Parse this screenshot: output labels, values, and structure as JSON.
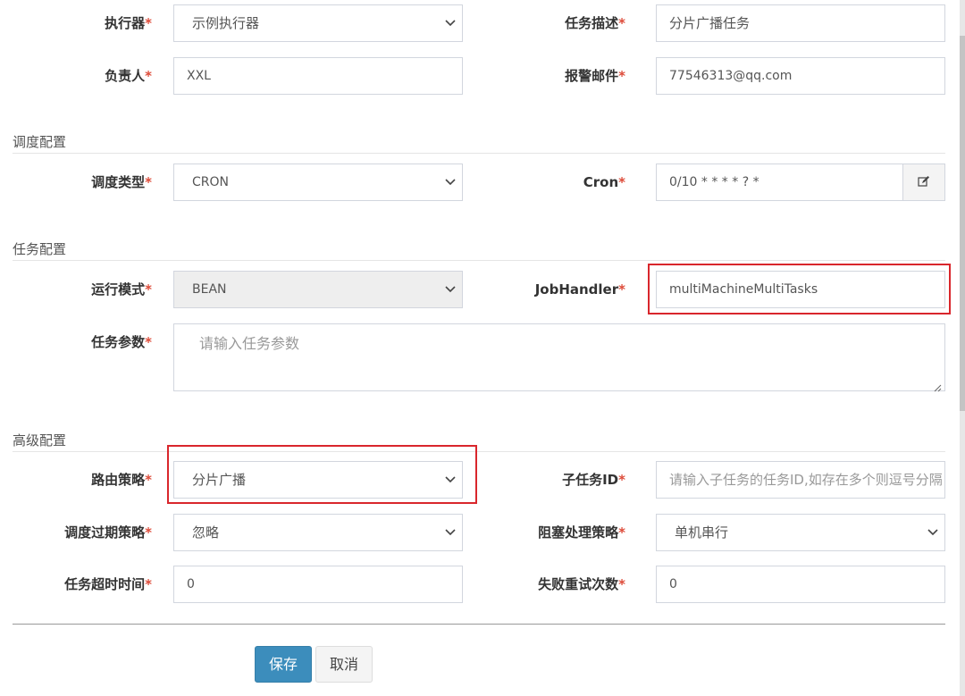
{
  "form": {
    "executor": {
      "label": "执行器",
      "required": "*",
      "value": "示例执行器"
    },
    "job_desc": {
      "label": "任务描述",
      "required": "*",
      "value": "分片广播任务"
    },
    "owner": {
      "label": "负责人",
      "required": "*",
      "value": "XXL"
    },
    "alarm_email": {
      "label": "报警邮件",
      "required": "*",
      "value": "77546313@qq.com"
    },
    "schedule_section": {
      "title": "调度配置"
    },
    "schedule_type": {
      "label": "调度类型",
      "required": "*",
      "value": "CRON"
    },
    "cron": {
      "label": "Cron",
      "required": "*",
      "value": "0/10 * * * * ? *"
    },
    "task_section": {
      "title": "任务配置"
    },
    "run_mode": {
      "label": "运行模式",
      "required": "*",
      "value": "BEAN"
    },
    "job_handler": {
      "label": "JobHandler",
      "required": "*",
      "value": "multiMachineMultiTasks"
    },
    "job_params": {
      "label": "任务参数",
      "required": "*",
      "placeholder": "请输入任务参数"
    },
    "advanced_section": {
      "title": "高级配置"
    },
    "route_strategy": {
      "label": "路由策略",
      "required": "*",
      "value": "分片广播"
    },
    "child_job_id": {
      "label": "子任务ID",
      "required": "*",
      "placeholder": "请输入子任务的任务ID,如存在多个则逗号分隔"
    },
    "misfire_strategy": {
      "label": "调度过期策略",
      "required": "*",
      "value": "忽略"
    },
    "block_strategy": {
      "label": "阻塞处理策略",
      "required": "*",
      "value": "单机串行"
    },
    "timeout": {
      "label": "任务超时时间",
      "required": "*",
      "value": "0"
    },
    "fail_retry": {
      "label": "失败重试次数",
      "required": "*",
      "value": "0"
    }
  },
  "buttons": {
    "save": "保存",
    "cancel": "取消"
  },
  "colors": {
    "required": "#dd4b39",
    "primary": "#3c8dbc",
    "highlight": "#d9262c"
  },
  "icons": {
    "select_arrow": "chevron-down-icon",
    "cron_edit": "edit-icon"
  }
}
